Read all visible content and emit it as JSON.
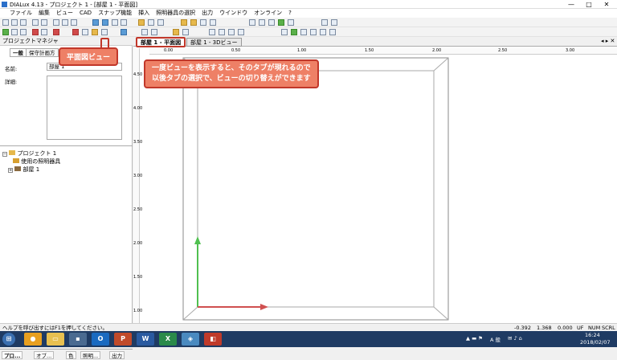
{
  "window": {
    "title": "DIALux 4.13 - プロジェクト 1 - [部屋 1 - 平面図]"
  },
  "menu": [
    "ファイル",
    "編集",
    "ビュー",
    "CAD",
    "スナップ機能",
    "挿入",
    "照明器具の選択",
    "出力",
    "ウインドウ",
    "オンライン",
    "?"
  ],
  "left_panel": {
    "title": "プロジェクトマネジャ",
    "tabs": [
      "一般",
      "保守計画方"
    ],
    "name_label": "名前:",
    "name_value": "部屋 1",
    "detail_label": "詳細:",
    "tree": [
      {
        "label": "プロジェクト 1"
      },
      {
        "label": "使用の照明器具"
      },
      {
        "label": "部屋 1"
      }
    ],
    "bottom_tabs": [
      "プロ...",
      "オブ...",
      "色",
      "照明...",
      "出力"
    ]
  },
  "view": {
    "tabs": [
      {
        "label": "部屋 1 - 平面図",
        "active": true
      },
      {
        "label": "部屋 1 - 3Dビュー",
        "active": false
      }
    ],
    "ruler_h": [
      "0.00",
      "0.50",
      "1.00",
      "1.50",
      "2.00",
      "2.50",
      "3.00",
      "3.50",
      "4.00",
      "4.50",
      "5.00",
      "5.50",
      "6.00"
    ],
    "ruler_v": [
      "4.50",
      "4.00",
      "3.50",
      "3.00",
      "2.50",
      "2.00",
      "1.50",
      "1.00",
      "0.50"
    ]
  },
  "callouts": {
    "plan_view": "平面図ビュー",
    "hint_line1": "一度ビューを表示すると、そのタブが現れるので",
    "hint_line2": "以後タブの選択で、ビューの切り替えができます"
  },
  "status": {
    "help": "ヘルプを呼び出すにはF1を押してください。",
    "x": "-0.392",
    "y": "1.368",
    "z": "0.000",
    "flags": [
      "UF",
      "NUM",
      "SCRL"
    ]
  },
  "taskbar": {
    "time": "16:24",
    "date": "2018/02/07",
    "ime": "A 般"
  },
  "colors": {
    "callout_fill": "#ee8066",
    "callout_border": "#c1372a",
    "axis_x": "#d05050",
    "axis_y": "#50c050"
  }
}
